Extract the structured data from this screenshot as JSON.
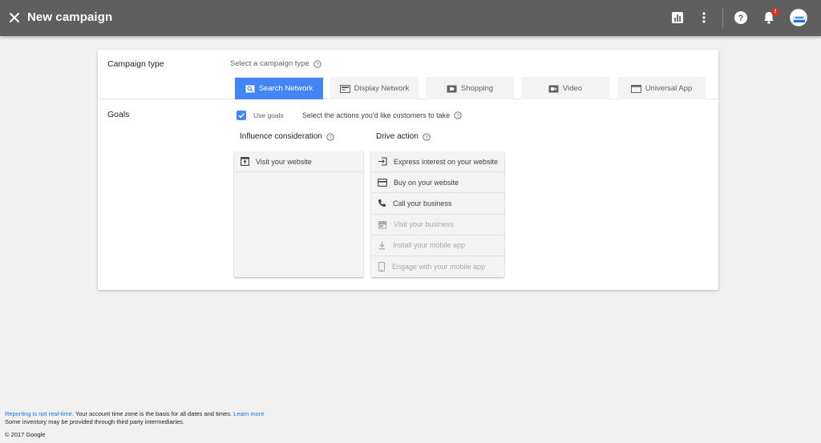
{
  "header": {
    "title": "New campaign",
    "notification_badge": "!"
  },
  "campaign_type": {
    "label": "Campaign type",
    "prompt": "Select a campaign type",
    "tabs": [
      {
        "label": "Search Network",
        "icon": "search-icon",
        "active": true
      },
      {
        "label": "Display Network",
        "icon": "display-icon",
        "active": false
      },
      {
        "label": "Shopping",
        "icon": "tag-icon",
        "active": false
      },
      {
        "label": "Video",
        "icon": "video-icon",
        "active": false
      },
      {
        "label": "Universal App",
        "icon": "app-icon",
        "active": false
      }
    ]
  },
  "goals": {
    "label": "Goals",
    "use_goals_label": "Use goals",
    "use_goals_checked": true,
    "prompt": "Select the actions you'd like customers to take",
    "influence": {
      "title": "Influence consideration",
      "items": [
        {
          "label": "Visit your website",
          "icon": "website-icon",
          "enabled": true
        }
      ]
    },
    "drive": {
      "title": "Drive action",
      "items": [
        {
          "label": "Express interest on your website",
          "icon": "sign-in-icon",
          "enabled": true
        },
        {
          "label": "Buy on your website",
          "icon": "credit-card-icon",
          "enabled": true
        },
        {
          "label": "Call your business",
          "icon": "phone-icon",
          "enabled": true
        },
        {
          "label": "Visit your business",
          "icon": "store-icon",
          "enabled": false
        },
        {
          "label": "Install your mobile app",
          "icon": "download-icon",
          "enabled": false
        },
        {
          "label": "Engage with your mobile app",
          "icon": "mobile-icon",
          "enabled": false
        }
      ]
    }
  },
  "footer": {
    "reporting_link": "Reporting is not real-time.",
    "reporting_text": " Your account time zone is the basis for all dates and times. ",
    "learn_more": "Learn more",
    "inventory_text": "Some inventory may be provided through third party intermediaries.",
    "copyright": "© 2017 Google"
  },
  "colors": {
    "accent": "#4285f4",
    "topbar": "#5f5f5f",
    "badge": "#d93025"
  }
}
